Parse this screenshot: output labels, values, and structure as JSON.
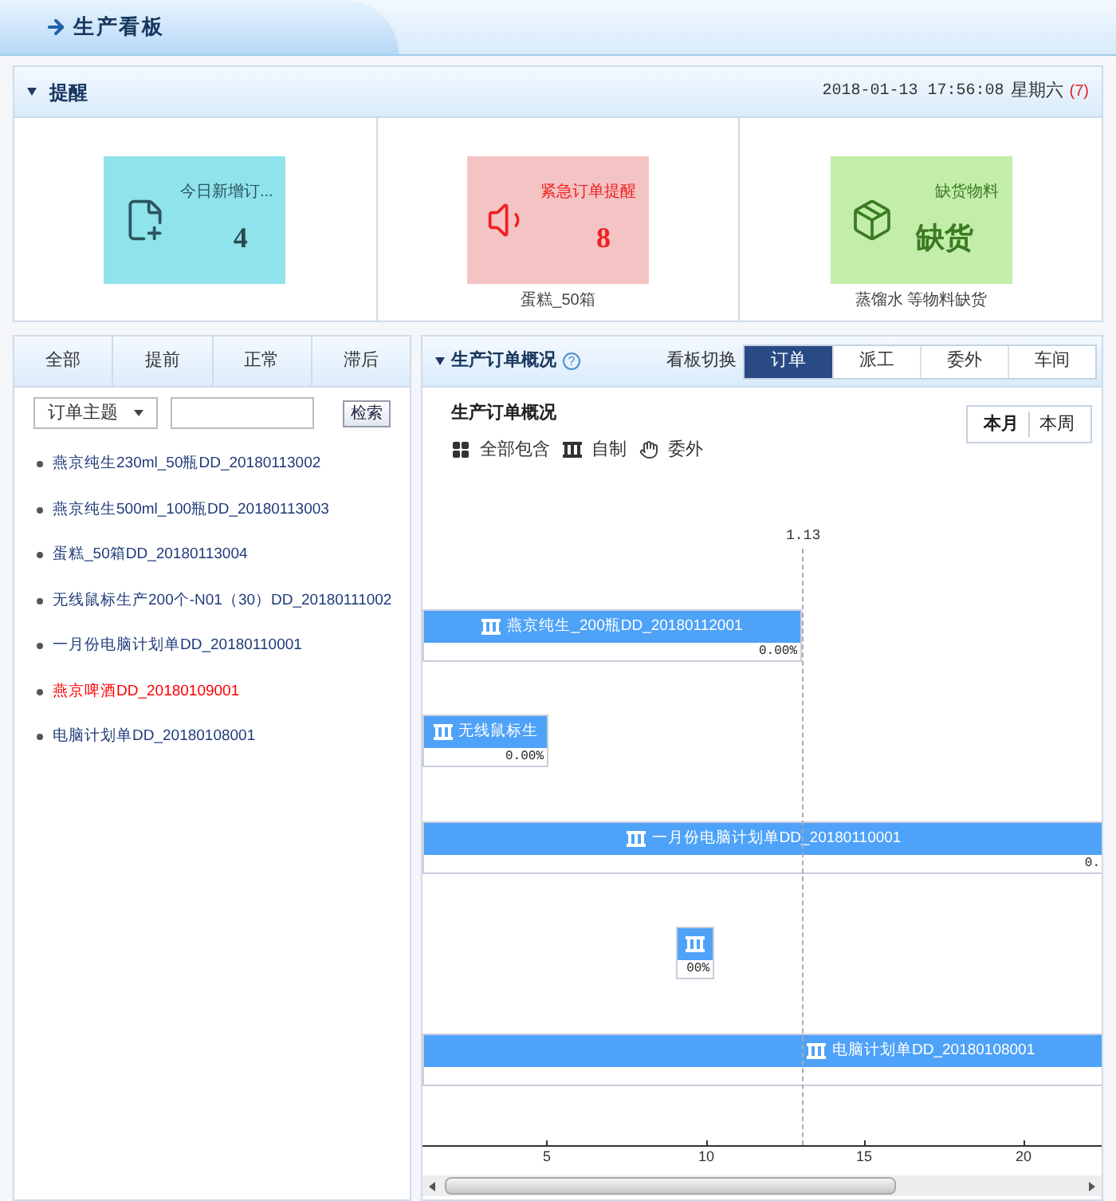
{
  "header": {
    "title": "生产看板"
  },
  "reminder": {
    "title": "提醒",
    "datetime": "2018-01-13 17:56:08",
    "weekday": "星期六",
    "week_number": "(7)",
    "cards": [
      {
        "kind": "new",
        "label": "今日新增订...",
        "value": "4"
      },
      {
        "kind": "urgent",
        "label": "紧急订单提醒",
        "value": "8",
        "caption": "蛋糕_50箱"
      },
      {
        "kind": "shortage",
        "label": "缺货物料",
        "value": "缺货",
        "caption": "蒸馏水 等物料缺货"
      }
    ]
  },
  "filters": {
    "tabs": [
      "全部",
      "提前",
      "正常",
      "滞后"
    ],
    "dropdown": "订单主题",
    "search_button": "检索"
  },
  "orders": [
    {
      "text": "燕京纯生230ml_50瓶DD_20180113002",
      "color": "#1f3a7a"
    },
    {
      "text": "燕京纯生500ml_100瓶DD_20180113003",
      "color": "#1f3a7a"
    },
    {
      "text": "蛋糕_50箱DD_20180113004",
      "color": "#1f3a7a"
    },
    {
      "text": "无线鼠标生产200个-N01（30）DD_20180111002",
      "color": "#1f3a7a"
    },
    {
      "text": "一月份电脑计划单DD_20180110001",
      "color": "#1f3a7a"
    },
    {
      "text": "燕京啤酒DD_20180109001",
      "color": "#ff0000"
    },
    {
      "text": "电脑计划单DD_20180108001",
      "color": "#1f3a7a"
    }
  ],
  "overview": {
    "title": "生产订单概况",
    "help": "?",
    "switch_label": "看板切换",
    "tabs": [
      {
        "label": "订单",
        "selected": true
      },
      {
        "label": "派工",
        "selected": false
      },
      {
        "label": "委外",
        "selected": false
      },
      {
        "label": "车间",
        "selected": false
      }
    ],
    "subtitle": "生产订单概况",
    "range_tabs": [
      {
        "label": "本月",
        "selected": true
      },
      {
        "label": "本周",
        "selected": false
      }
    ],
    "legend": [
      {
        "kind": "all",
        "label": "全部包含"
      },
      {
        "kind": "self",
        "label": "自制"
      },
      {
        "kind": "outsourced",
        "label": "委外"
      }
    ],
    "gantt": {
      "marker": "1.13",
      "bars": [
        {
          "label": "燕京纯生_200瓶DD_20180112001",
          "progress": "0.00%"
        },
        {
          "label": "无线鼠标生",
          "progress": "0.00%"
        },
        {
          "label": "一月份电脑计划单DD_20180110001",
          "progress": "0."
        },
        {
          "progress": "00%"
        },
        {
          "label": "电脑计划单DD_20180108001"
        }
      ],
      "ticks": [
        "5",
        "10",
        "15",
        "20"
      ]
    }
  }
}
